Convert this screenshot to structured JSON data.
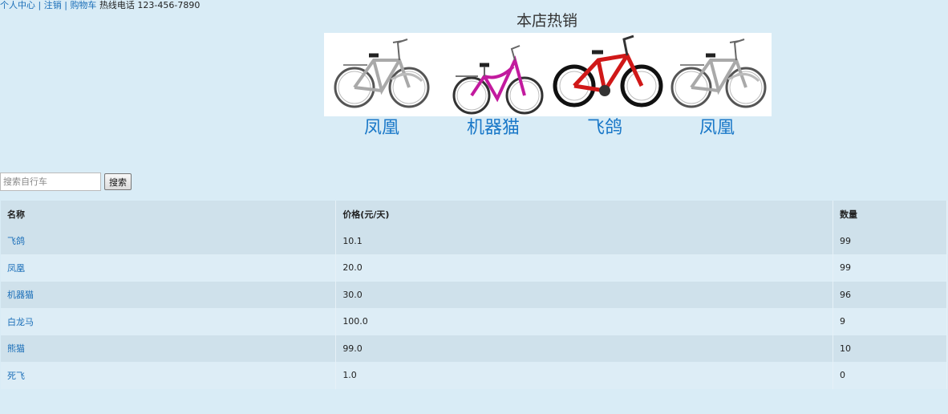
{
  "topbar": {
    "profile_link": "个人中心",
    "logout_link": "注销",
    "cart_link": "购物车",
    "separator": "|",
    "hotline": "热线电话 123-456-7890"
  },
  "hot": {
    "title": "本店热销",
    "items": [
      {
        "name": "凤凰",
        "icon": "city-bike-silver",
        "color": "#9a9a9a"
      },
      {
        "name": "机器猫",
        "icon": "city-bike-pink",
        "color": "#c21a9e"
      },
      {
        "name": "飞鸽",
        "icon": "mountain-bike-red",
        "color": "#d01818"
      },
      {
        "name": "凤凰",
        "icon": "city-bike-silver",
        "color": "#9a9a9a"
      }
    ]
  },
  "search": {
    "placeholder": "搜索自行车",
    "button": "搜索"
  },
  "table": {
    "headers": [
      "名称",
      "价格(元/天)",
      "数量"
    ],
    "rows": [
      {
        "name": "飞鸽",
        "price": "10.1",
        "qty": "99"
      },
      {
        "name": "凤凰",
        "price": "20.0",
        "qty": "99"
      },
      {
        "name": "机器猫",
        "price": "30.0",
        "qty": "96"
      },
      {
        "name": "白龙马",
        "price": "100.0",
        "qty": "9"
      },
      {
        "name": "熊猫",
        "price": "99.0",
        "qty": "10"
      },
      {
        "name": "死飞",
        "price": "1.0",
        "qty": "0"
      }
    ]
  }
}
